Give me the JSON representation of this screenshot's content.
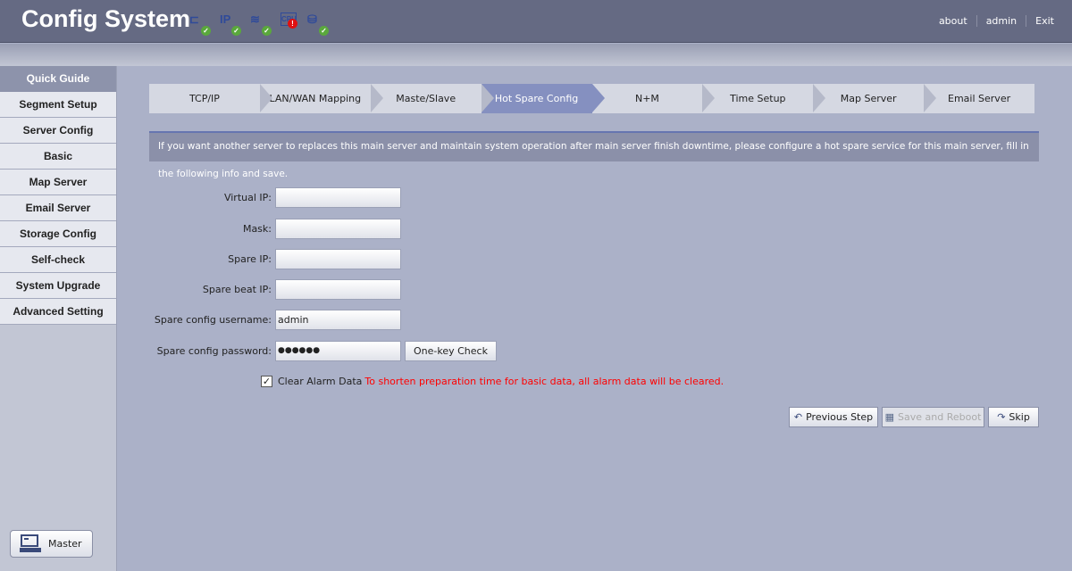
{
  "header": {
    "title": "Config System",
    "status_icons": [
      {
        "name": "network-icon",
        "glyph": "⊏",
        "status": "ok"
      },
      {
        "name": "ip-icon",
        "glyph": "IP",
        "status": "ok"
      },
      {
        "name": "signal-icon",
        "glyph": "≋",
        "status": "ok"
      },
      {
        "name": "cpu-icon",
        "glyph": "CPU",
        "status": "error"
      },
      {
        "name": "disk-icon",
        "glyph": "⛁",
        "status": "ok"
      }
    ],
    "links": [
      "about",
      "admin",
      "Exit"
    ]
  },
  "sidebar": {
    "head": "Quick Guide",
    "items": [
      "Segment Setup",
      "Server Config",
      "Basic",
      "Map Server",
      "Email Server",
      "Storage Config",
      "Self-check",
      "System Upgrade",
      "Advanced Setting"
    ],
    "master": "Master"
  },
  "steps": [
    "TCP/IP",
    "LAN/WAN Mapping",
    "Maste/Slave",
    "Hot Spare Config",
    "N+M",
    "Time Setup",
    "Map Server",
    "Email Server"
  ],
  "active_step": "Hot Spare Config",
  "info": "If you want another server to replaces this main server and maintain system operation after main server finish downtime, please configure a hot spare service for this main server, fill in the following info and save.",
  "form": {
    "virtual_ip": {
      "label": "Virtual IP:",
      "value": ""
    },
    "mask": {
      "label": "Mask:",
      "value": ""
    },
    "spare_ip": {
      "label": "Spare IP:",
      "value": ""
    },
    "spare_beat_ip": {
      "label": "Spare beat IP:",
      "value": ""
    },
    "username": {
      "label": "Spare config username:",
      "value": "admin"
    },
    "password": {
      "label": "Spare config password:",
      "value": "●●●●●●"
    },
    "one_key_check": "One-key Check",
    "clear_alarm": {
      "label": "Clear Alarm Data",
      "checked": true,
      "warning": "To shorten preparation time for basic data, all alarm data will be cleared."
    }
  },
  "actions": {
    "previous": "Previous Step",
    "save": "Save and Reboot",
    "skip": "Skip"
  }
}
